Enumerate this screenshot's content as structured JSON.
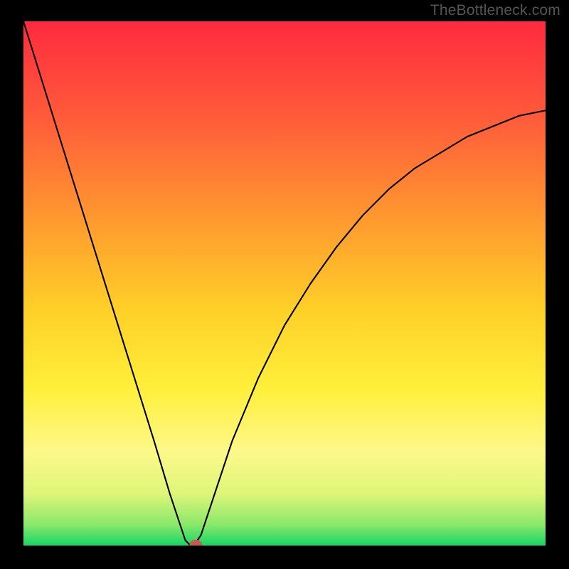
{
  "watermark": "TheBottleneck.com",
  "chart_data": {
    "type": "line",
    "title": "",
    "xlabel": "",
    "ylabel": "",
    "xlim": [
      0,
      100
    ],
    "ylim": [
      0,
      100
    ],
    "gradient_stops": [
      {
        "offset": 0.0,
        "color": "#ff2a3f"
      },
      {
        "offset": 0.18,
        "color": "#ff5a3a"
      },
      {
        "offset": 0.38,
        "color": "#ff9a2f"
      },
      {
        "offset": 0.55,
        "color": "#ffd028"
      },
      {
        "offset": 0.7,
        "color": "#ffef3a"
      },
      {
        "offset": 0.82,
        "color": "#fdf88a"
      },
      {
        "offset": 0.9,
        "color": "#dff67a"
      },
      {
        "offset": 0.96,
        "color": "#8ae86a"
      },
      {
        "offset": 1.0,
        "color": "#17d665"
      }
    ],
    "series": [
      {
        "name": "bottleneck-curve",
        "x": [
          0,
          5,
          10,
          15,
          20,
          25,
          28,
          30,
          31,
          32,
          33,
          34,
          36,
          40,
          45,
          50,
          55,
          60,
          65,
          70,
          75,
          80,
          85,
          90,
          95,
          100
        ],
        "y": [
          100,
          84,
          68,
          52,
          36,
          20,
          10,
          4,
          1,
          0,
          0.5,
          2,
          8,
          20,
          32,
          42,
          50,
          57,
          63,
          68,
          72,
          75,
          78,
          80,
          82,
          83
        ]
      }
    ],
    "marker": {
      "x": 33,
      "y": 0.2,
      "rx": 1.2,
      "ry": 0.9
    },
    "colors": {
      "curve": "#000000",
      "marker": "#c85a52",
      "background": "#000000"
    }
  }
}
